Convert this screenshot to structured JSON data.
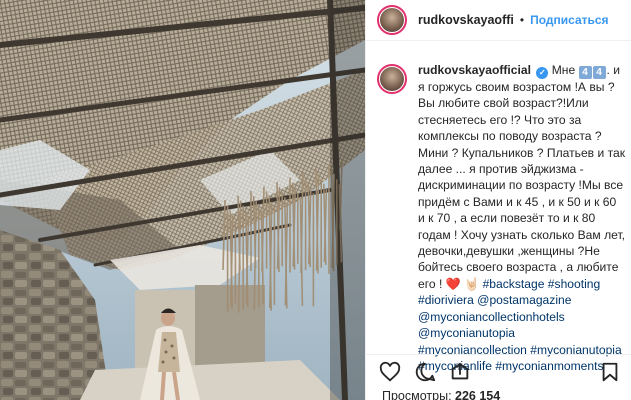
{
  "post": {
    "username": "rudkovskayaoffi",
    "follow_label": "Подписаться",
    "separator": "•"
  },
  "caption": {
    "author": "rudkovskayaofficial",
    "verified_icon": "verified-badge-icon",
    "num_a": "4",
    "num_b": "4",
    "part1": "Мне ",
    "part2": ". и я горжусь своим возрастом !А вы ?Вы любите свой возраст?!Или стесняетесь его !? Что это за комплексы по поводу возраста ? Мини ? Купальников ? Платьев и так далее ... я против эйджизма - дискриминации по возрасту !Мы все придём с Вами и к 45 , и к 50 и к 60 и к 70 , а если повезёт то и к 80 годам ! Хочу узнать сколько Вам лет, девочки,девушки ,женщины ?Не бойтесь своего возраста , а любите его ! ",
    "heart": "❤️",
    "hand": "🤘🏻",
    "tags": [
      "#backstage",
      "#shooting",
      "#dioriviera",
      "@postamagazine",
      "@myconiancollectionhotels",
      "@myconianutopia",
      "#myconiancollection",
      "#myconianutopia",
      "#myconianlife",
      "#myconianmoments"
    ]
  },
  "stats": {
    "views_label": "Просмотры:",
    "views_count": "226 154"
  },
  "icons": {
    "like": "heart-outline-icon",
    "comment": "comment-bubble-icon",
    "share": "share-arrow-icon",
    "save": "bookmark-icon"
  }
}
